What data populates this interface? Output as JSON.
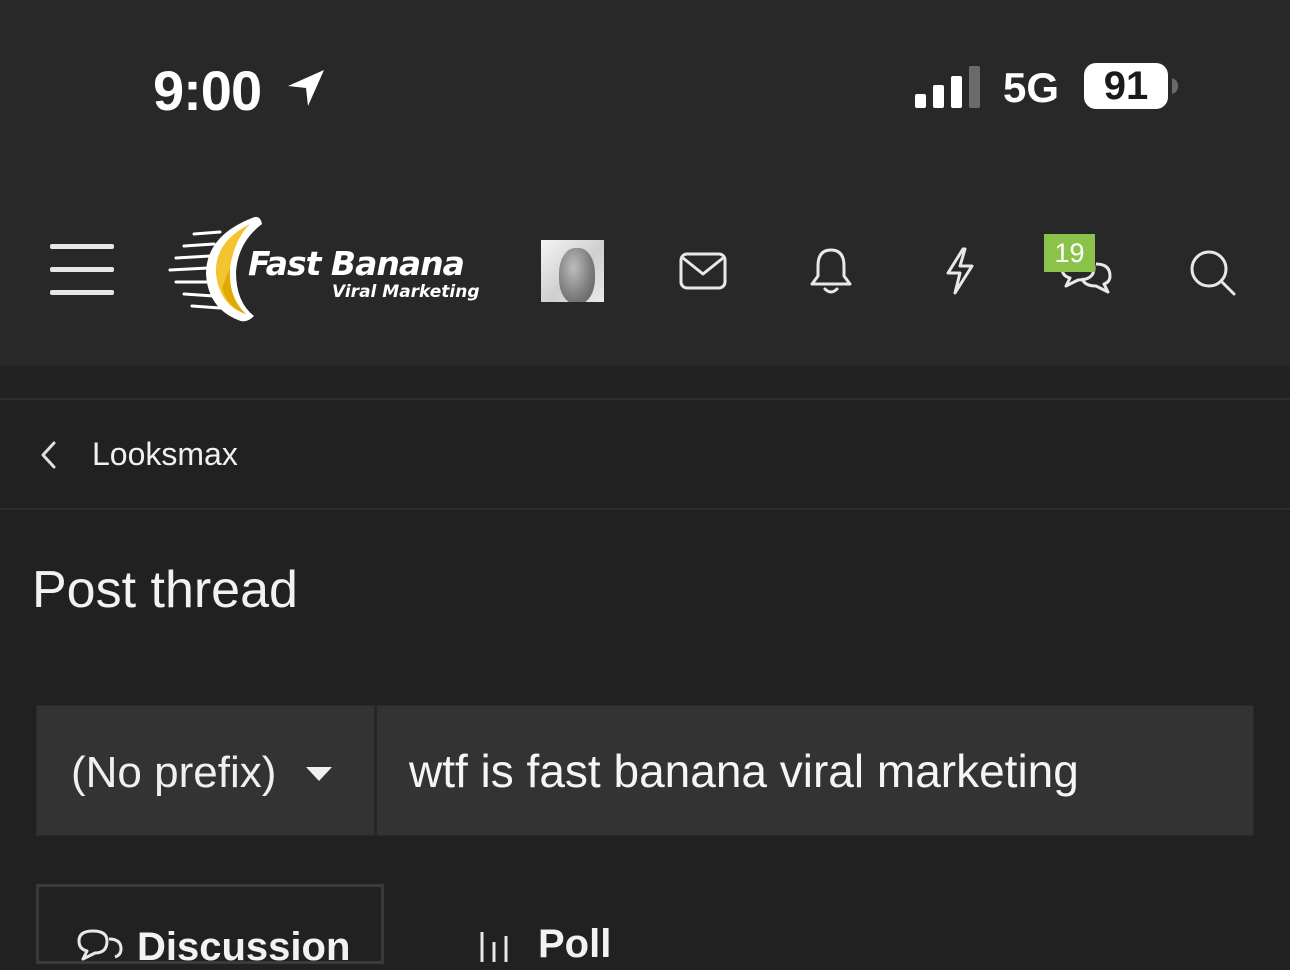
{
  "status_bar": {
    "time": "9:00",
    "network": "5G",
    "battery": "91"
  },
  "header": {
    "logo_title": "Fast Banana",
    "logo_subtitle": "Viral Marketing",
    "conversations_badge": "19",
    "accent_color": "#8bc34a"
  },
  "breadcrumb": {
    "label": "Looksmax"
  },
  "page": {
    "title": "Post thread"
  },
  "form": {
    "prefix_value": "(No prefix)",
    "title_value": "wtf is fast banana viral marketing"
  },
  "tabs": [
    {
      "label": "Discussion"
    },
    {
      "label": "Poll"
    }
  ]
}
